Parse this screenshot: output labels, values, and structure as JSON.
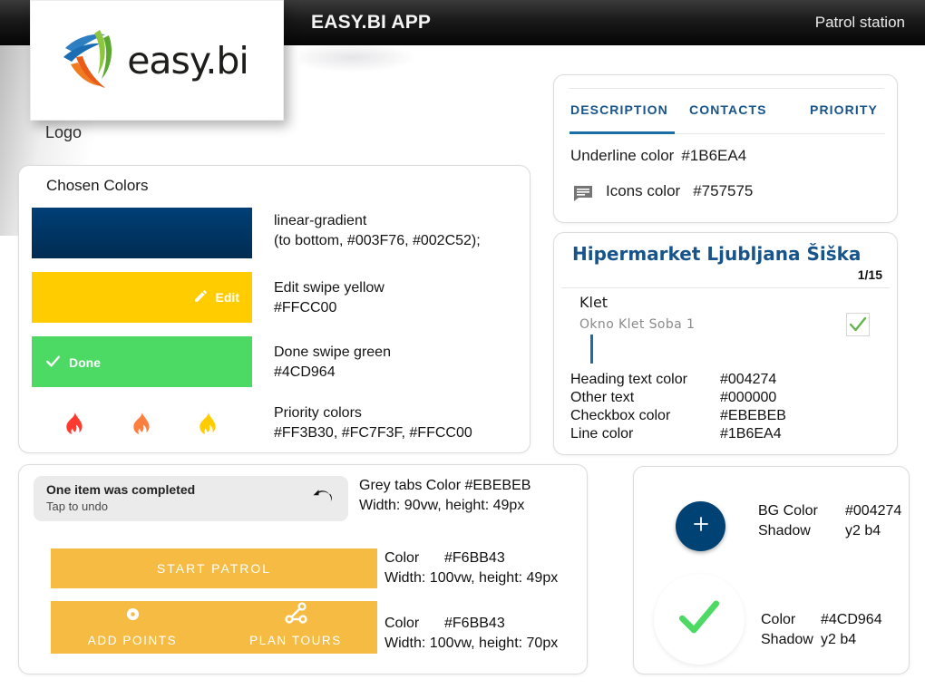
{
  "header": {
    "title": "EASY.BI APP",
    "right_label": "Patrol station"
  },
  "logo": {
    "brand_text": "easy.bi",
    "caption": "Logo",
    "icon": "easybi-swoosh-logo"
  },
  "chosen_colors": {
    "title": "Chosen Colors",
    "swatches": [
      {
        "name": "primary-gradient",
        "label": "",
        "icon": "",
        "desc_line1": "linear-gradient",
        "desc_line2": "(to bottom, #003F76, #002C52);",
        "color_from": "#003F76",
        "color_to": "#002C52"
      },
      {
        "name": "edit-swipe",
        "label": "Edit",
        "icon": "pencil-icon",
        "desc_line1": "Edit swipe yellow",
        "desc_line2": "#FFCC00",
        "color": "#FFCC00"
      },
      {
        "name": "done-swipe",
        "label": "Done",
        "icon": "check-icon",
        "desc_line1": "Done swipe green",
        "desc_line2": "#4CD964",
        "color": "#4CD964"
      }
    ],
    "priority": {
      "desc_line1": "Priority colors",
      "desc_line2": "#FF3B30, #FC7F3F, #FFCC00",
      "flame_colors": [
        "#FF3B30",
        "#FC7F3F",
        "#FFCC00"
      ]
    }
  },
  "tabs_card": {
    "tabs": [
      {
        "label": "DESCRIPTION",
        "active": true
      },
      {
        "label": "CONTACTS",
        "active": false
      },
      {
        "label": "PRIORITY",
        "active": false
      }
    ],
    "tab_color": "#17548A",
    "rows": [
      {
        "key": "Underline color",
        "value": "#1B6EA4",
        "icon": ""
      },
      {
        "key": "Icons color",
        "value": "#757575",
        "icon": "chat-icon"
      }
    ]
  },
  "hipermarket_card": {
    "title": "Hipermarket Ljubljana Šiška",
    "counter": "1/15",
    "section": "Klet",
    "item": "Okno Klet Soba 1",
    "checkbox_checked": true,
    "specs": [
      {
        "key": "Heading text color",
        "value": "#004274"
      },
      {
        "key": "Other text",
        "value": "#000000"
      },
      {
        "key": "Checkbox color",
        "value": "#EBEBEB"
      },
      {
        "key": "Line color",
        "value": "#1B6EA4"
      }
    ]
  },
  "buttons_card": {
    "snackbar": {
      "title": "One item was completed",
      "subtitle": "Tap to undo",
      "icon": "undo-icon",
      "bg": "#EBEBEB"
    },
    "snackbar_note_line1": "Grey tabs Color #EBEBEB",
    "snackbar_note_line2": "Width: 90vw, height: 49px",
    "start_button": {
      "label": "START PATROL",
      "color": "#F6BB43"
    },
    "start_note": {
      "key": "Color",
      "value": "#F6BB43",
      "size": "Width: 100vw, height: 49px"
    },
    "dual_button": {
      "left_label": "ADD POINTS",
      "left_icon": "point-marker-icon",
      "right_label": "PLAN TOURS",
      "right_icon": "route-nodes-icon",
      "color": "#F6BB43"
    },
    "dual_note": {
      "key": "Color",
      "value": "#F6BB43",
      "size": "Width: 100vw, height: 70px"
    }
  },
  "fab_card": {
    "fab": {
      "icon": "plus-icon",
      "bg": "#004274"
    },
    "fab_note": {
      "key": "BG Color",
      "value": "#004274",
      "shadow_key": "Shadow",
      "shadow_value": "y2 b4"
    },
    "check": {
      "icon": "check-icon",
      "color": "#4CD964"
    },
    "check_note": {
      "key": "Color",
      "value": "#4CD964",
      "shadow_key": "Shadow",
      "shadow_value": "y2 b4"
    }
  }
}
